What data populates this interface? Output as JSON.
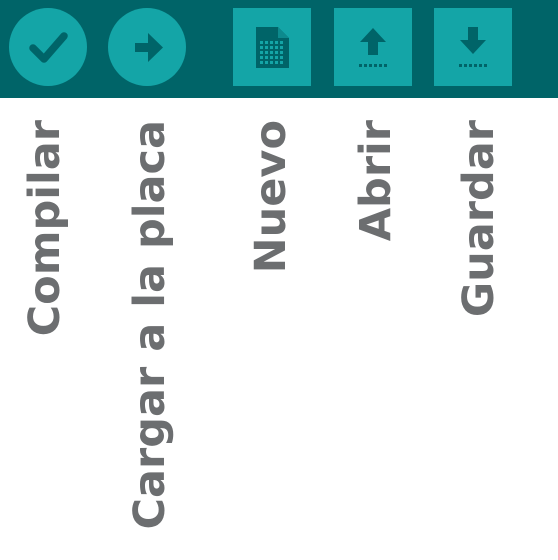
{
  "toolbar": {
    "colors": {
      "bar": "#006468",
      "button": "#14a5a7",
      "icon": "#006468",
      "label": "#6c6e70"
    },
    "buttons": [
      {
        "id": "verify",
        "icon": "checkmark-icon",
        "label": "Compilar"
      },
      {
        "id": "upload",
        "icon": "arrow-right-icon",
        "label": "Cargar a la placa"
      },
      {
        "id": "new",
        "icon": "new-document-icon",
        "label": "Nuevo"
      },
      {
        "id": "open",
        "icon": "arrow-up-icon",
        "label": "Abrir"
      },
      {
        "id": "save",
        "icon": "arrow-down-icon",
        "label": "Guardar"
      }
    ]
  }
}
